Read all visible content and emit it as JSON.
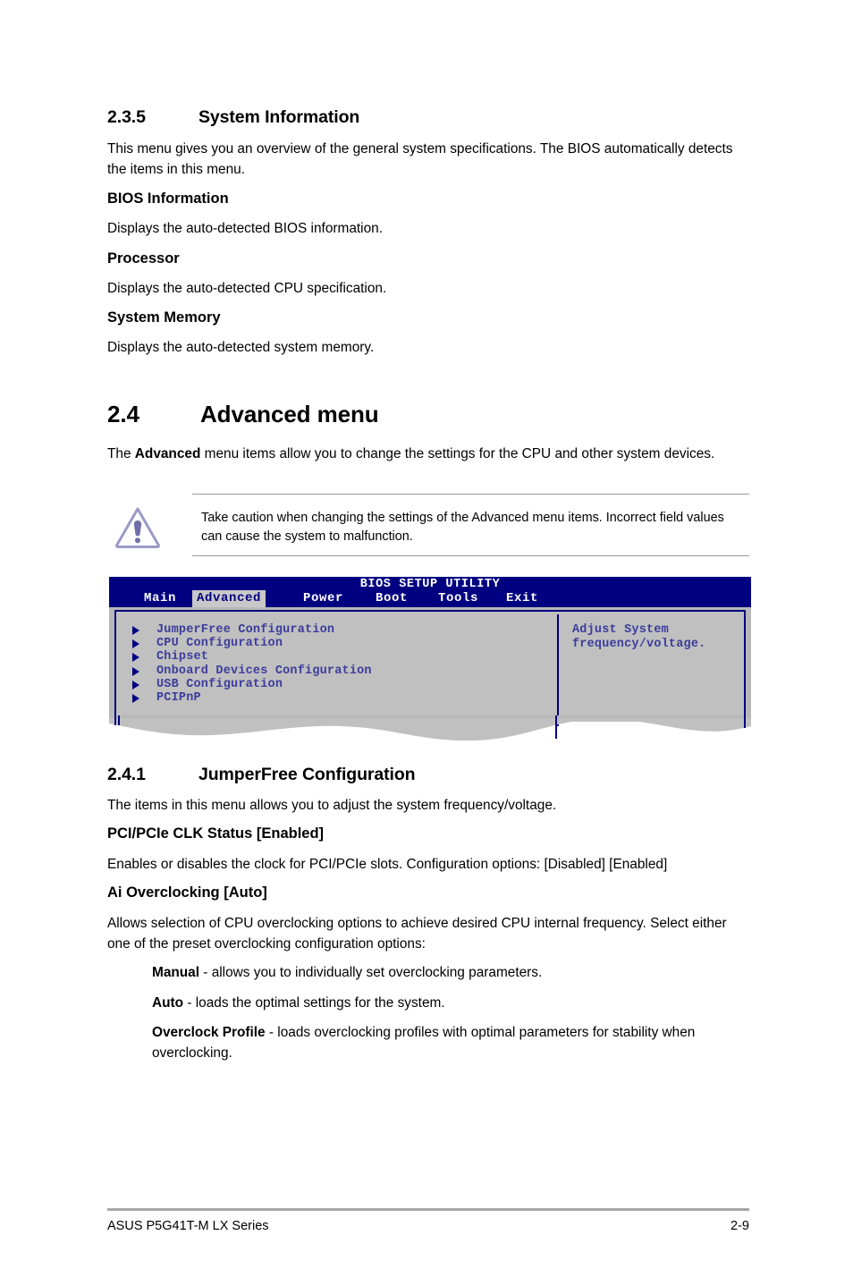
{
  "sections": {
    "system_information": {
      "number": "2.3.5",
      "title": "System Information",
      "intro": "This menu gives you an overview of the general system specifications. The BIOS automatically detects the items in this menu.",
      "subsections": [
        {
          "heading": "BIOS Information",
          "body": "Displays the auto-detected BIOS information."
        },
        {
          "heading": "Processor",
          "body": "Displays the auto-detected CPU specification."
        },
        {
          "heading": "System Memory",
          "body": "Displays the auto-detected system memory."
        }
      ]
    },
    "advanced_menu": {
      "number": "2.4",
      "title": "Advanced menu",
      "intro_prefix": "The ",
      "intro_bold": "Advanced",
      "intro_suffix": " menu items allow you to change the settings for the CPU and other system devices.",
      "caution": "Take caution when changing the settings of the Advanced menu items. Incorrect field values can cause the system to malfunction.",
      "caution_icon": "warning-triangle-icon"
    },
    "jumperfree": {
      "number": "2.4.1",
      "title": "JumperFree Configuration",
      "intro": "The items in this menu allows you to adjust the system frequency/voltage.",
      "items": [
        {
          "heading": "PCI/PCIe CLK Status [Enabled]",
          "body": "Enables or disables the clock for PCI/PCIe slots. Configuration options: [Disabled] [Enabled]"
        },
        {
          "heading": "Ai Overclocking [Auto]",
          "body": "Allows selection of CPU overclocking options to achieve desired CPU internal frequency. Select either one of the preset overclocking configuration options:"
        }
      ],
      "options": [
        {
          "term": "Manual",
          "desc": " - allows you to individually set overclocking parameters."
        },
        {
          "term": "Auto",
          "desc": " - loads the optimal settings for the system."
        },
        {
          "term": "Overclock Profile",
          "desc": " - loads overclocking profiles with optimal parameters for stability when overclocking."
        }
      ]
    }
  },
  "bios_screen": {
    "title": "BIOS SETUP UTILITY",
    "tabs": [
      {
        "label": "Main",
        "active": false
      },
      {
        "label": "Advanced",
        "active": true
      },
      {
        "label": "Power",
        "active": false
      },
      {
        "label": "Boot",
        "active": false
      },
      {
        "label": "Tools",
        "active": false
      },
      {
        "label": "Exit",
        "active": false
      }
    ],
    "menu_items": [
      "JumperFree Configuration",
      "CPU Configuration",
      "Chipset",
      "Onboard Devices Configuration",
      "USB Configuration",
      "PCIPnP"
    ],
    "help_line_1": "Adjust System",
    "help_line_2": "frequency/voltage.",
    "colors": {
      "header_bg": "#000080",
      "body_bg": "#c0c0c0",
      "text_blue": "#3c3c9c",
      "active_tab_bg": "#c8c8c8"
    }
  },
  "footer": {
    "left": "ASUS P5G41T-M LX Series",
    "right": "2-9"
  }
}
